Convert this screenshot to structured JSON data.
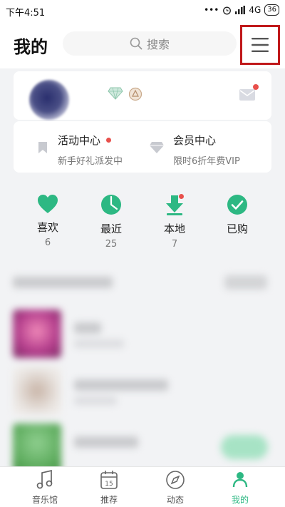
{
  "status_bar": {
    "time": "下午4:51",
    "dots": "•••",
    "network": "4G",
    "battery": "36"
  },
  "header": {
    "title": "我的",
    "search_placeholder": "搜索"
  },
  "promo": {
    "activity": {
      "title": "活动中心",
      "subtitle": "新手好礼派发中"
    },
    "vip": {
      "title": "会员中心",
      "subtitle": "限时6折年费VIP"
    }
  },
  "shortcuts": [
    {
      "label": "喜欢",
      "count": "6"
    },
    {
      "label": "最近",
      "count": "25"
    },
    {
      "label": "本地",
      "count": "7"
    },
    {
      "label": "已购",
      "count": ""
    }
  ],
  "tabs": [
    {
      "label": "音乐馆",
      "icon": "note-icon"
    },
    {
      "label": "推荐",
      "icon": "calendar-icon",
      "day": "15"
    },
    {
      "label": "动态",
      "icon": "compass-icon"
    },
    {
      "label": "我的",
      "icon": "profile-icon",
      "active": true
    }
  ],
  "colors": {
    "accent": "#2db883",
    "highlight_box": "#c0191b",
    "badge_red": "#e8504c"
  }
}
